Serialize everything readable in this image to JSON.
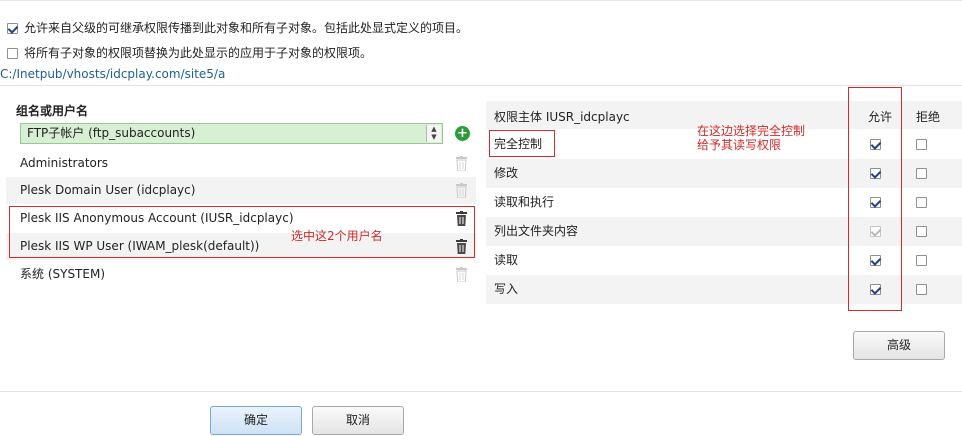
{
  "options": {
    "inherit_label": "允许来自父级的可继承权限传播到此对象和所有子对象。包括此处显式定义的项目。",
    "inherit_checked": true,
    "replace_label": "将所有子对象的权限项替换为此处显示的应用于子对象的权限项。",
    "replace_checked": false
  },
  "path": "C:/Inetpub/vhosts/idcplay.com/site5/a",
  "users": {
    "title": "组名或用户名",
    "selected_value": "FTP子帐户 (ftp_subaccounts)",
    "rows": [
      {
        "label": "Administrators"
      },
      {
        "label": "Plesk Domain User (idcplayc)"
      },
      {
        "label": "Plesk IIS Anonymous Account (IUSR_idcplayc)"
      },
      {
        "label": "Plesk IIS WP User (IWAM_plesk(default))"
      },
      {
        "label": "系统 (SYSTEM)"
      }
    ],
    "annotation": "选中这2个用户名"
  },
  "permissions": {
    "principal_label": "权限主体 IUSR_idcplayc",
    "allow_header": "允许",
    "deny_header": "拒绝",
    "rows": [
      {
        "label": "完全控制",
        "allow": true,
        "deny": false
      },
      {
        "label": "修改",
        "allow": true,
        "deny": false
      },
      {
        "label": "读取和执行",
        "allow": true,
        "deny": false
      },
      {
        "label": "列出文件夹内容",
        "allow": true,
        "deny": false
      },
      {
        "label": "读取",
        "allow": true,
        "deny": false
      },
      {
        "label": "写入",
        "allow": true,
        "deny": false
      }
    ],
    "annotation_line1": "在这边选择完全控制",
    "annotation_line2": "给予其读写权限",
    "advanced_label": "高级"
  },
  "footer": {
    "ok_label": "确定",
    "cancel_label": "取消"
  },
  "colors": {
    "annotation": "#d12b2b",
    "path": "#1e5f8f",
    "selected_user_bg": "#d7f0d3"
  }
}
